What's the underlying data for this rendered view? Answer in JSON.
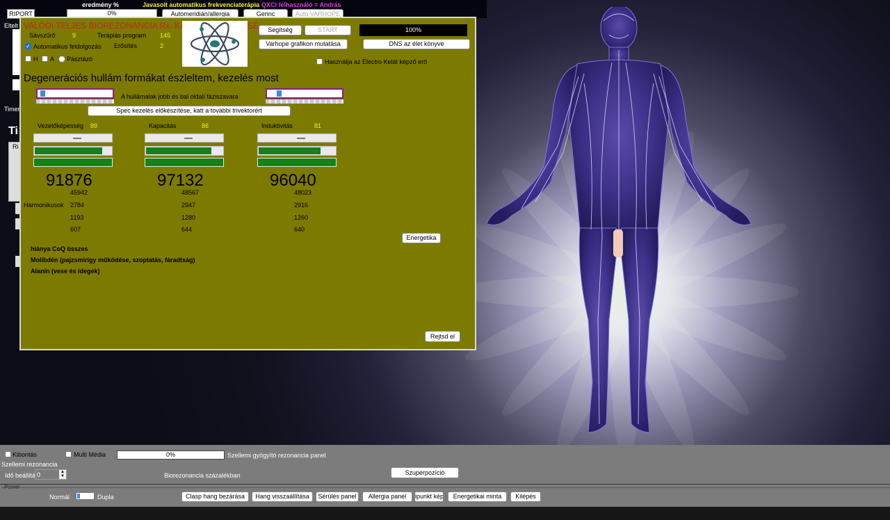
{
  "top": {
    "eredmeny_label": "eredmény %",
    "eredmeny_value": "0%",
    "suggested": "Javasolt automatikus frekvenciaterápia",
    "user": "QXCI felhasználó = András",
    "riport": "RIPORT",
    "elteit": "Eltelt",
    "timer": "Timer",
    "btn_automeridian": "Automeridián/allergia",
    "btn_gerinc": "Gerinc",
    "btn_auto_varhope": "Auto VARHOPE",
    "tiny_ti": "Ti",
    "tiny_ri": "Ri"
  },
  "panel": {
    "title": "VALÓDI TELJES BIOREZONANCIA Rx. KA",
    "title_tail": "SÉ",
    "savszuro_label": "Sávszűrő",
    "savszuro_value": "9",
    "terapias_label": "Terápiás program",
    "terapias_value": "145",
    "auto_label": "Automatikus feldolgozás",
    "erosites_label": "Erősítés",
    "erosites_value": "2",
    "radio_h": "H",
    "radio_a": "A",
    "radio_pasztazo": "Pásztázó",
    "btn_segitseg": "Segítség",
    "btn_start": "START",
    "progress": "100%",
    "btn_varhope": "Varhope grafikon mutatása",
    "btn_dns": "DNS az élet könyve",
    "electro_label": "Használja az Electro Kelát képző erő",
    "heading": "Degenerációs hullám formákat észleltem, kezelés most",
    "phase_label": "A hullámalak jobb és bal oldali fáziszavara",
    "btn_spec": "Spec kezelés előkészítése, katt a további trivektorért",
    "btn_energetika": "Energetika",
    "btn_rejtsd": "Rejtsd el",
    "harmonikusok": "Harmonikusok",
    "columns": [
      {
        "label": "Vezetőképesség",
        "value": "89",
        "big": "91876",
        "h1": "45942",
        "h2": "2784",
        "h3": "1193",
        "h4": "607",
        "fill1": 0.88,
        "fill2": 1.0
      },
      {
        "label": "Kapacitás",
        "value": "86",
        "big": "97132",
        "h1": "48567",
        "h2": "2947",
        "h3": "1280",
        "h4": "644",
        "fill1": 0.85,
        "fill2": 1.0
      },
      {
        "label": "Induktivitás",
        "value": "81",
        "big": "96040",
        "h1": "48023",
        "h2": "2916",
        "h3": "1260",
        "h4": "640",
        "fill1": 0.81,
        "fill2": 1.0
      }
    ],
    "deficits": [
      "hiánya CoQ összes",
      "Molibdén (pajzsmirigy működése, szoptatás, fáradtság)",
      "Alanin (vese és idegek)"
    ]
  },
  "bottom": {
    "kibontas": "Kibontás",
    "multimedia": "Multi Média",
    "progress": "0%",
    "szellemi_panel": "Szellemi gyógyító rezonancia panel",
    "szellemi_rez": "Szellemi rezonancia",
    "ido_label": "Idő beállítá",
    "ido_value": "0",
    "biorez": "Biorezonancia százalékban",
    "btn_szuperpozicio": "Szuperpozíció",
    "power": "Power",
    "normal": "Normál",
    "dupla": "Dupla",
    "buttons": [
      "Clasp hang bezárása",
      "Hang visszaállítása",
      "Sérülés panel",
      "Allergia panel",
      "ipunkt kép",
      "Energetikai minta",
      "Kilépés"
    ]
  },
  "colors": {
    "panel": "#7d7a00",
    "accent_yellow": "#f3ee30",
    "green": "#18801a",
    "progress": "#000000"
  }
}
